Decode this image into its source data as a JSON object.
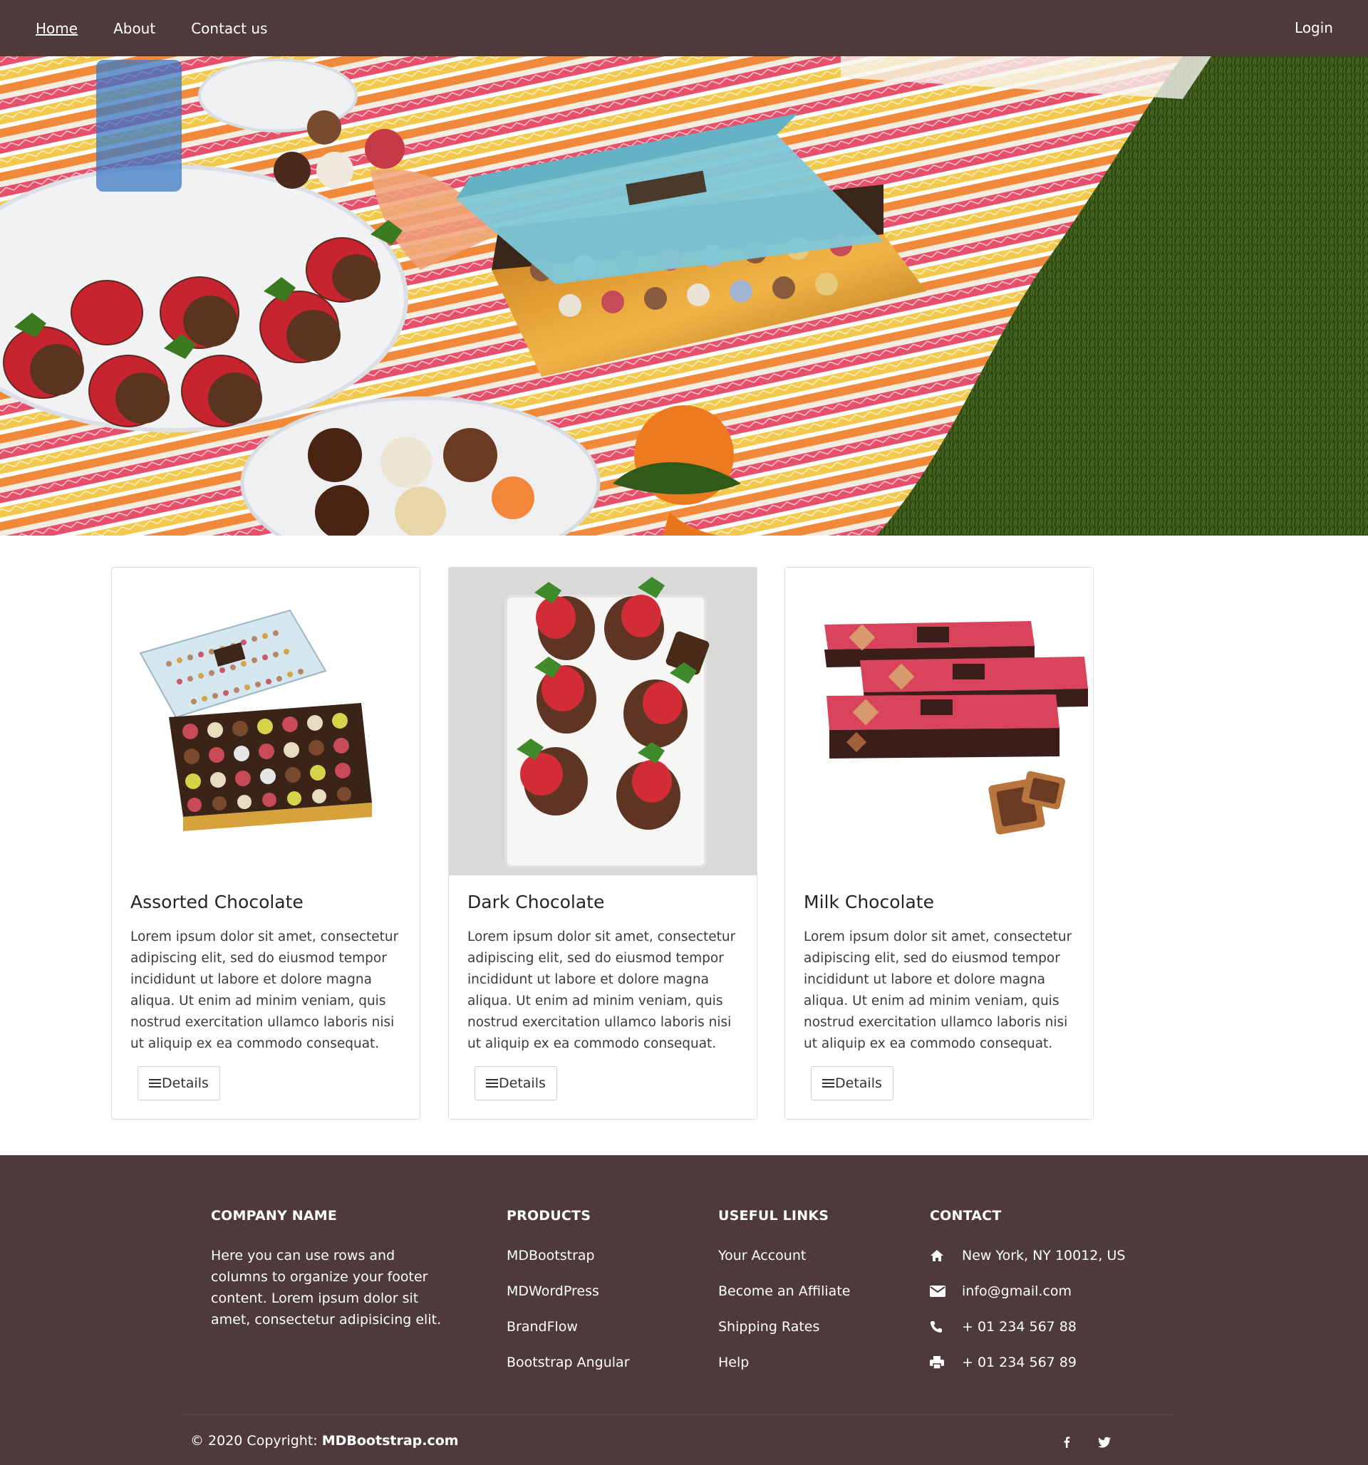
{
  "nav": {
    "links": [
      "Home",
      "About",
      "Contact us"
    ],
    "active": "Home",
    "login": "Login"
  },
  "hero": {
    "image": "picnic-chocolate-photo"
  },
  "cards": [
    {
      "title": "Assorted Chocolate",
      "text": "Lorem ipsum dolor sit amet, consectetur adipiscing elit, sed do eiusmod tempor incididunt ut labore et dolore magna aliqua. Ut enim ad minim veniam, quis nostrud exercitation ullamco laboris nisi ut aliquip ex ea commodo consequat.",
      "button": "Details",
      "image": "assorted-chocolate-box-photo"
    },
    {
      "title": "Dark Chocolate",
      "text": "Lorem ipsum dolor sit amet, consectetur adipiscing elit, sed do eiusmod tempor incididunt ut labore et dolore magna aliqua. Ut enim ad minim veniam, quis nostrud exercitation ullamco laboris nisi ut aliquip ex ea commodo consequat.",
      "button": "Details",
      "image": "chocolate-strawberries-photo"
    },
    {
      "title": "Milk Chocolate",
      "text": "Lorem ipsum dolor sit amet, consectetur adipiscing elit, sed do eiusmod tempor incididunt ut labore et dolore magna aliqua. Ut enim ad minim veniam, quis nostrud exercitation ullamco laboris nisi ut aliquip ex ea commodo consequat.",
      "button": "Details",
      "image": "milk-chocolate-boxes-photo"
    }
  ],
  "footer": {
    "company": {
      "heading": "COMPANY NAME",
      "text": "Here you can use rows and columns to organize your footer content. Lorem ipsum dolor sit amet, consectetur adipisicing elit."
    },
    "products": {
      "heading": "PRODUCTS",
      "links": [
        "MDBootstrap",
        "MDWordPress",
        "BrandFlow",
        "Bootstrap Angular"
      ]
    },
    "useful": {
      "heading": "USEFUL LINKS",
      "links": [
        "Your Account",
        "Become an Affiliate",
        "Shipping Rates",
        "Help"
      ]
    },
    "contact": {
      "heading": "CONTACT",
      "items": [
        {
          "icon": "home-icon",
          "text": "New York, NY 10012, US"
        },
        {
          "icon": "envelope-icon",
          "text": "info@gmail.com"
        },
        {
          "icon": "phone-icon",
          "text": "+ 01 234 567 88"
        },
        {
          "icon": "print-icon",
          "text": "+ 01 234 567 89"
        }
      ]
    },
    "copyright": {
      "prefix": "© 2020 Copyright: ",
      "brand": "MDBootstrap.com"
    },
    "social": [
      "facebook-icon",
      "twitter-icon"
    ]
  },
  "colors": {
    "nav_bg": "#4e3a3a",
    "footer_bg": "#4e3a3a"
  }
}
